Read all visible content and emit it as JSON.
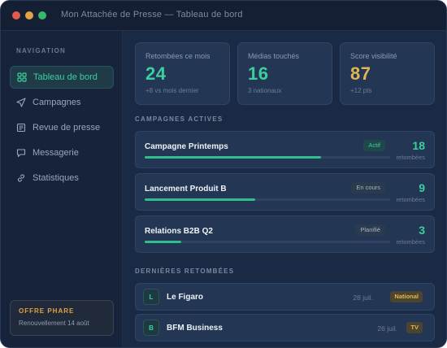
{
  "window": {
    "title": "Mon Attachée de Presse — Tableau de bord"
  },
  "sidebar": {
    "heading": "NAVIGATION",
    "items": [
      {
        "label": "Tableau de bord",
        "icon": "grid-icon",
        "active": true
      },
      {
        "label": "Campagnes",
        "icon": "send-icon",
        "active": false
      },
      {
        "label": "Revue de presse",
        "icon": "newspaper-icon",
        "active": false
      },
      {
        "label": "Messagerie",
        "icon": "chat-icon",
        "active": false
      },
      {
        "label": "Statistiques",
        "icon": "link-icon",
        "active": false
      }
    ],
    "offer": {
      "title": "OFFRE PHARE",
      "subtitle": "Renouvellement 14 août"
    }
  },
  "stats": [
    {
      "label": "Retombées ce mois",
      "value": "24",
      "sub": "+8 vs mois dernier",
      "color": "#3ccf9d"
    },
    {
      "label": "Médias touchés",
      "value": "16",
      "sub": "3 nationaux",
      "color": "#3ccf9d"
    },
    {
      "label": "Score visibilité",
      "value": "87",
      "sub": "+12 pts",
      "color": "#e0b651"
    }
  ],
  "campaigns": {
    "heading": "CAMPAGNES ACTIVES",
    "unit": "retombées",
    "items": [
      {
        "name": "Campagne Printemps",
        "status": "Actif",
        "status_style": "green",
        "count": "18",
        "progress": 0.72
      },
      {
        "name": "Lancement Produit B",
        "status": "En cours",
        "status_style": "grey",
        "count": "9",
        "progress": 0.45
      },
      {
        "name": "Relations B2B Q2",
        "status": "Planifié",
        "status_style": "grey",
        "count": "3",
        "progress": 0.15
      }
    ]
  },
  "hits": {
    "heading": "DERNIÈRES RETOMBÉES",
    "items": [
      {
        "initial": "L",
        "name": "Le Figaro",
        "date": "28 juil.",
        "tag": "National"
      },
      {
        "initial": "B",
        "name": "BFM Business",
        "date": "26 juil.",
        "tag": "TV"
      }
    ]
  },
  "colors": {
    "accent": "#3ccf9d",
    "warning": "#e0a341",
    "background": "#1b2a44"
  }
}
